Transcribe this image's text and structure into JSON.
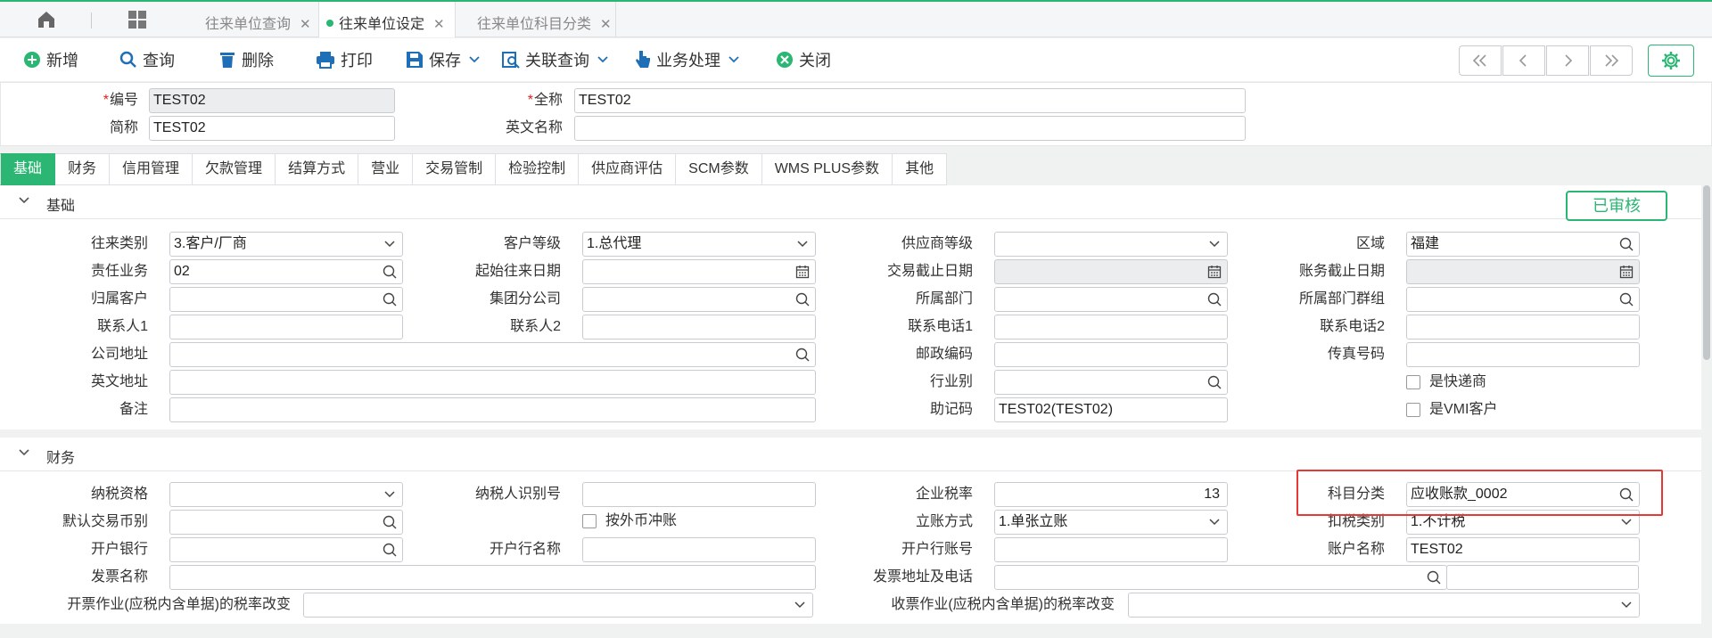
{
  "tabs": [
    {
      "label": "往来单位查询"
    },
    {
      "label": "往来单位设定"
    },
    {
      "label": "往来单位科目分类"
    }
  ],
  "toolbar": {
    "add": "新增",
    "query": "查询",
    "delete": "删除",
    "print": "打印",
    "save": "保存",
    "related_query": "关联查询",
    "business": "业务处理",
    "close": "关闭"
  },
  "header": {
    "code_label": "编号",
    "code_value": "TEST02",
    "fullname_label": "全称",
    "fullname_value": "TEST02",
    "short_label": "简称",
    "short_value": "TEST02",
    "english_label": "英文名称",
    "english_value": ""
  },
  "detail_tabs": [
    "基础",
    "财务",
    "信用管理",
    "欠款管理",
    "结算方式",
    "营业",
    "交易管制",
    "检验控制",
    "供应商评估",
    "SCM参数",
    "WMS PLUS参数",
    "其他"
  ],
  "status": "已审核",
  "basic": {
    "title": "基础",
    "fields": {
      "partner_type": {
        "label": "往来类别",
        "value": "3.客户/厂商"
      },
      "customer_level": {
        "label": "客户等级",
        "value": "1.总代理"
      },
      "supplier_level": {
        "label": "供应商等级",
        "value": ""
      },
      "region": {
        "label": "区域",
        "value": "福建"
      },
      "salesman": {
        "label": "责任业务",
        "value": "02"
      },
      "start_date": {
        "label": "起始往来日期",
        "value": ""
      },
      "trade_end_date": {
        "label": "交易截止日期",
        "value": ""
      },
      "account_end_date": {
        "label": "账务截止日期",
        "value": ""
      },
      "parent_customer": {
        "label": "归属客户",
        "value": ""
      },
      "group_branch": {
        "label": "集团分公司",
        "value": ""
      },
      "department": {
        "label": "所属部门",
        "value": ""
      },
      "dept_group": {
        "label": "所属部门群组",
        "value": ""
      },
      "contact1": {
        "label": "联系人1",
        "value": ""
      },
      "contact2": {
        "label": "联系人2",
        "value": ""
      },
      "phone1": {
        "label": "联系电话1",
        "value": ""
      },
      "phone2": {
        "label": "联系电话2",
        "value": ""
      },
      "address": {
        "label": "公司地址",
        "value": ""
      },
      "postcode": {
        "label": "邮政编码",
        "value": ""
      },
      "fax": {
        "label": "传真号码",
        "value": ""
      },
      "en_address": {
        "label": "英文地址",
        "value": ""
      },
      "industry": {
        "label": "行业别",
        "value": ""
      },
      "is_courier": {
        "label": "是快递商",
        "checked": false
      },
      "remark": {
        "label": "备注",
        "value": ""
      },
      "mnemonic": {
        "label": "助记码",
        "value": "TEST02(TEST02)"
      },
      "is_vmi": {
        "label": "是VMI客户",
        "checked": false
      }
    }
  },
  "finance": {
    "title": "财务",
    "fields": {
      "tax_qual": {
        "label": "纳税资格",
        "value": ""
      },
      "taxpayer_id": {
        "label": "纳税人识别号",
        "value": ""
      },
      "tax_rate": {
        "label": "企业税率",
        "value": "13"
      },
      "subject_class": {
        "label": "科目分类",
        "value": "应收账款_0002"
      },
      "default_currency": {
        "label": "默认交易币别",
        "value": ""
      },
      "offset_foreign": {
        "label": "按外币冲账",
        "checked": false
      },
      "account_method": {
        "label": "立账方式",
        "value": "1.单张立账"
      },
      "deduct_type": {
        "label": "扣税类别",
        "value": "1.不计税"
      },
      "bank": {
        "label": "开户银行",
        "value": ""
      },
      "bank_name": {
        "label": "开户行名称",
        "value": ""
      },
      "bank_account": {
        "label": "开户行账号",
        "value": ""
      },
      "account_name": {
        "label": "账户名称",
        "value": "TEST02"
      },
      "invoice_name": {
        "label": "发票名称",
        "value": ""
      },
      "invoice_addr_phone": {
        "label": "发票地址及电话",
        "value": ""
      },
      "invoice_tax_change": {
        "label": "开票作业(应税内含单据)的税率改变",
        "value": ""
      },
      "receipt_tax_change": {
        "label": "收票作业(应税内含单据)的税率改变",
        "value": ""
      }
    }
  },
  "colors": {
    "accent": "#2bb673",
    "highlight": "#e53935"
  }
}
